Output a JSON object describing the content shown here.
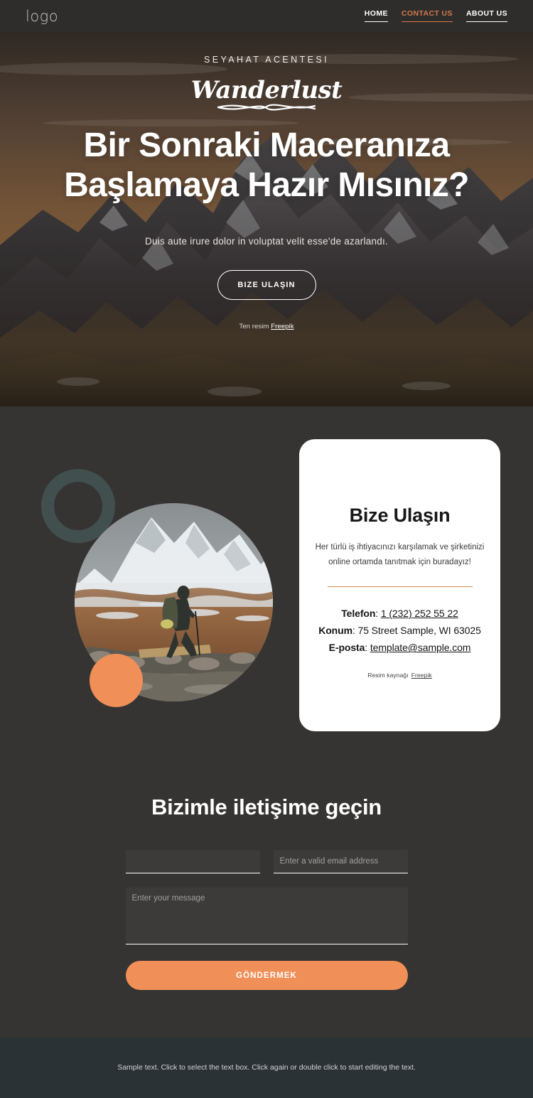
{
  "header": {
    "logo": "logo",
    "nav": [
      {
        "label": "HOME",
        "active": false
      },
      {
        "label": "CONTACT US",
        "active": true
      },
      {
        "label": "ABOUT US",
        "active": false
      }
    ]
  },
  "hero": {
    "eyebrow": "SEYAHAT ACENTESI",
    "brand_script": "Wanderlust",
    "title": "Bir Sonraki Maceranıza Başlamaya Hazır Mısınız?",
    "subtitle": "Duis aute irure dolor in voluptat velit esse'de azarlandı.",
    "cta_label": "BIZE ULAŞIN",
    "credit_prefix": "Ten resim",
    "credit_link": "Freepik"
  },
  "contact": {
    "card_title": "Bize Ulaşın",
    "card_description": "Her türlü iş ihtiyacınızı karşılamak ve şirketinizi online ortamda tanıtmak için buradayız!",
    "phone_label": "Telefon",
    "phone_value": "1 (232) 252 55 22",
    "location_label": "Konum",
    "location_value": "75 Street Sample, WI 63025",
    "email_label": "E-posta",
    "email_value": "template@sample.com",
    "credit_prefix": "Resim kaynağı",
    "credit_link": "Freepik",
    "photo_alt": "hiker-crossing-stream"
  },
  "form": {
    "title": "Bizimle iletişime geçin",
    "name_value": "",
    "name_placeholder": "",
    "email_value": "",
    "email_placeholder": "Enter a valid email address",
    "message_value": "",
    "message_placeholder": "Enter your message",
    "submit_label": "GÖNDERMEK"
  },
  "footer": {
    "text": "Sample text. Click to select the text box. Click again or double click to start editing the text."
  },
  "colors": {
    "accent_orange": "#f08f57",
    "nav_accent": "#d2794a",
    "page_bg": "#363433",
    "header_bg": "#2f2d2c",
    "footer_bg": "#2a3235",
    "ring_teal": "#41504f",
    "card_bg": "#ffffff",
    "divider_orange": "#d38b5e"
  }
}
